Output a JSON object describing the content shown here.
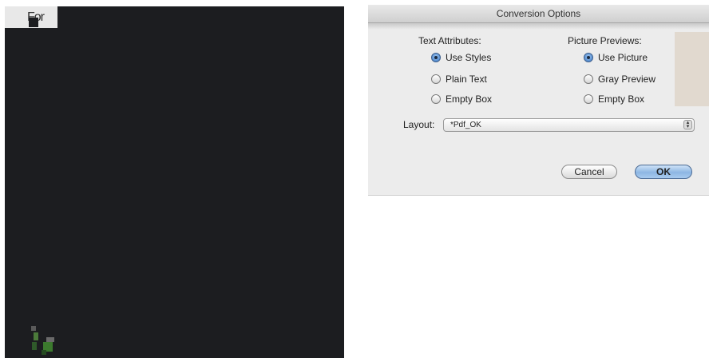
{
  "left_panel": {
    "tab_text": "For"
  },
  "dialog": {
    "title": "Conversion Options",
    "text_attributes": {
      "heading": "Text Attributes:",
      "options": [
        {
          "label": "Use Styles",
          "checked": true
        },
        {
          "label": "Plain Text",
          "checked": false
        },
        {
          "label": "Empty Box",
          "checked": false
        }
      ]
    },
    "picture_previews": {
      "heading": "Picture Previews:",
      "options": [
        {
          "label": "Use Picture",
          "checked": true
        },
        {
          "label": "Gray Preview",
          "checked": false
        },
        {
          "label": "Empty Box",
          "checked": false
        }
      ]
    },
    "layout": {
      "label": "Layout:",
      "value": "*Pdf_OK"
    },
    "buttons": {
      "cancel": "Cancel",
      "ok": "OK"
    }
  },
  "colors": {
    "dark_panel": "#1c1d20",
    "dialog_bg": "#ececec",
    "primary_button": "#8db6e3"
  }
}
